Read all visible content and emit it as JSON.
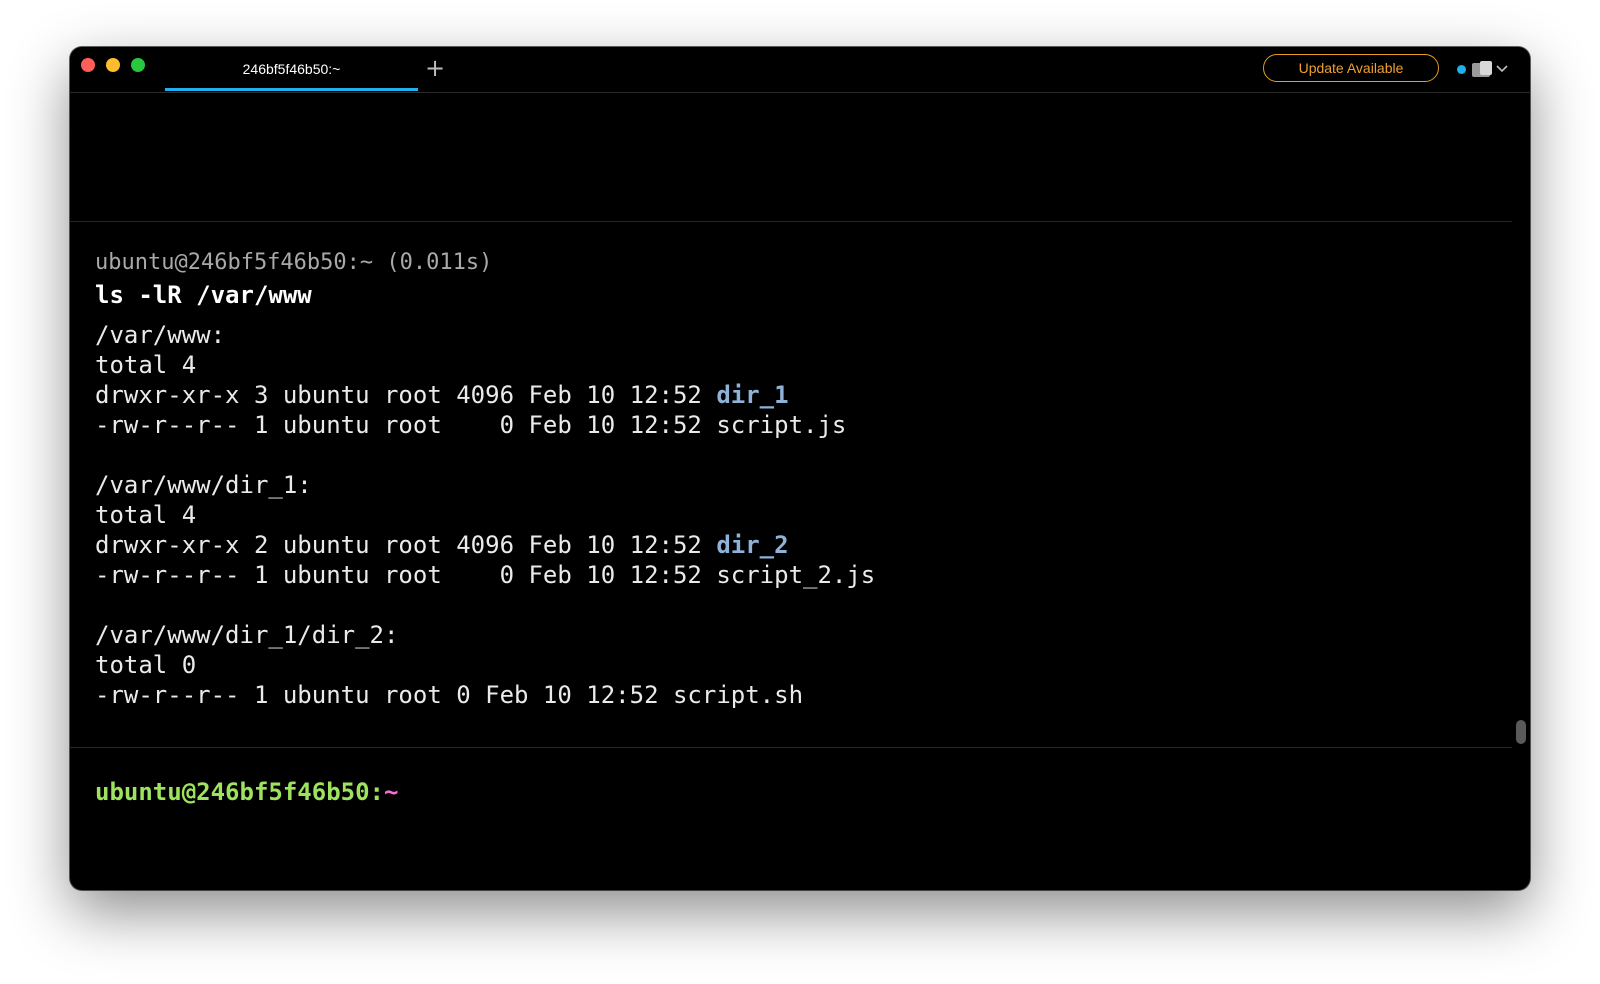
{
  "window": {
    "tab_title": "246bf5f46b50:~",
    "new_tab_symbol": "+",
    "update_button_label": "Update Available",
    "colors": {
      "accent": "#1fb0ef",
      "update_border": "#e89a23",
      "directory": "#8fb2d8",
      "prompt_user": "#9ee35d",
      "prompt_path": "#ff6bd5"
    }
  },
  "terminal": {
    "block": {
      "meta": "ubuntu@246bf5f46b50:~ (0.011s)",
      "command": "ls -lR /var/www",
      "output": [
        {
          "text": "/var/www:"
        },
        {
          "text": "total 4"
        },
        {
          "text": "drwxr-xr-x 3 ubuntu root 4096 Feb 10 12:52 ",
          "dir": "dir_1"
        },
        {
          "text": "-rw-r--r-- 1 ubuntu root    0 Feb 10 12:52 script.js"
        },
        {
          "text": "",
          "blank": true
        },
        {
          "text": "/var/www/dir_1:"
        },
        {
          "text": "total 4"
        },
        {
          "text": "drwxr-xr-x 2 ubuntu root 4096 Feb 10 12:52 ",
          "dir": "dir_2"
        },
        {
          "text": "-rw-r--r-- 1 ubuntu root    0 Feb 10 12:52 script_2.js"
        },
        {
          "text": "",
          "blank": true
        },
        {
          "text": "/var/www/dir_1/dir_2:"
        },
        {
          "text": "total 0"
        },
        {
          "text": "-rw-r--r-- 1 ubuntu root 0 Feb 10 12:52 script.sh"
        }
      ]
    },
    "prompt": {
      "user_host": "ubuntu@246bf5f46b50:",
      "path": "~"
    }
  }
}
